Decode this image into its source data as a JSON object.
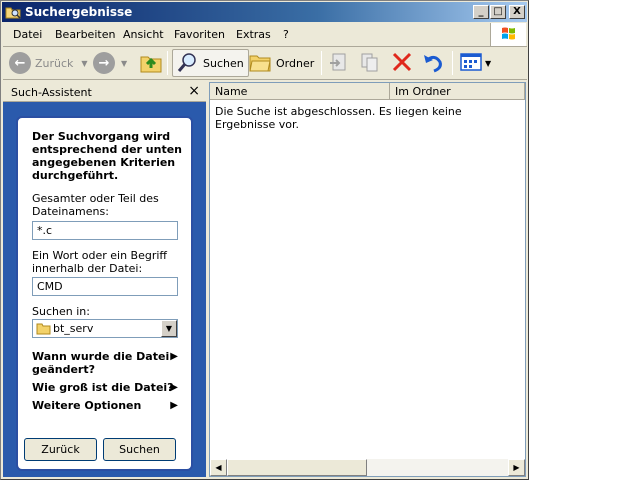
{
  "window": {
    "title": "Suchergebnisse",
    "controls": {
      "minimize": "_",
      "maximize": "□",
      "close": "X"
    }
  },
  "menu": [
    "Datei",
    "Bearbeiten",
    "Ansicht",
    "Favoriten",
    "Extras",
    "?"
  ],
  "toolbar": {
    "back_label": "Zurück",
    "search_label": "Suchen",
    "folders_label": "Ordner"
  },
  "assistant": {
    "title": "Such-Assistent",
    "close": "×",
    "intro": "Der Suchvorgang wird entsprechend der unten angegebenen Kriterien durchgeführt.",
    "filename_label": "Gesamter oder Teil des Dateinamens:",
    "filename_value": "*.c",
    "word_label": "Ein Wort oder ein Begriff innerhalb der Datei:",
    "word_value": "CMD",
    "lookin_label": "Suchen in:",
    "lookin_value": "bt_serv",
    "when_changed": "Wann wurde die Datei geändert?",
    "size": "Wie groß ist die Datei?",
    "more_options": "Weitere Optionen",
    "back_button": "Zurück",
    "search_button": "Suchen"
  },
  "results": {
    "columns": [
      "Name",
      "Im Ordner"
    ],
    "message": "Die Suche ist abgeschlossen. Es liegen keine Ergebnisse vor."
  }
}
